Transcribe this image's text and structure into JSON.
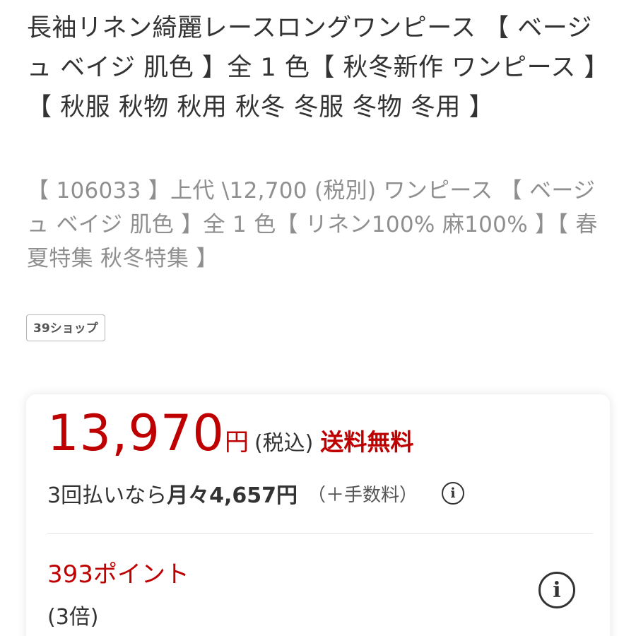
{
  "product": {
    "title": "長袖リネン綺麗レースロングワンピース 【 ベージュ ベイジ 肌色 】全 1 色【 秋冬新作 ワンピース 】【 秋服 秋物 秋用 秋冬 冬服 冬物 冬用 】",
    "description": "【 106033 】上代 \\12,700 (税別) ワンピース 【 ベージュ ベイジ 肌色 】全 1 色【 リネン100% 麻100% 】【 春夏特集 秋冬特集 】"
  },
  "shop": {
    "badge": "39ショップ"
  },
  "price": {
    "value": "13,970",
    "yen": "円",
    "tax": "(税込)",
    "shipping": "送料無料"
  },
  "installment": {
    "prefix": "3回払いなら",
    "amount": "月々4,657円",
    "fee": "（＋手数料）",
    "info_icon_glyph": "i"
  },
  "points": {
    "value": "393ポイント",
    "multiplier": "(3倍)",
    "info_icon_glyph": "i"
  },
  "colors": {
    "price_red": "#bf0000",
    "text": "#333333",
    "muted": "#8f8f8f"
  }
}
